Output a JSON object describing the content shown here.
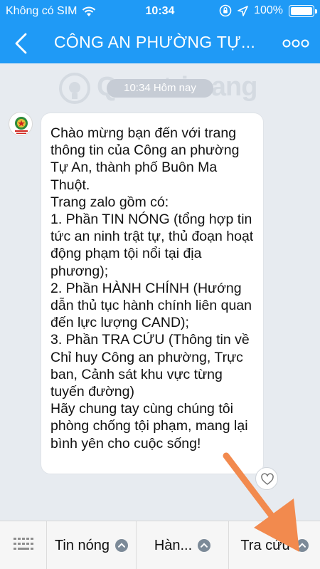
{
  "status_bar": {
    "carrier": "Không có SIM",
    "time": "10:34",
    "battery": "100%"
  },
  "header": {
    "title": "CÔNG AN PHƯỜNG TỰ...",
    "back_icon": "chevron-left-icon",
    "more_icon": "more-dots-icon"
  },
  "chat": {
    "timestamp": "10:34 Hôm nay",
    "watermark": "Quantrimang",
    "message": "Chào mừng bạn đến với trang thông tin của Công an phường Tự An, thành phố Buôn Ma Thuột.\n Trang zalo gồm có:\n 1. Phần TIN NÓNG (tổng hợp tin tức an ninh trật tự, thủ đoạn hoạt động phạm tội nổi tại địa phương);\n2. Phần HÀNH CHÍNH (Hướng dẫn thủ tục hành chính liên quan đến lực lượng CAND);\n3. Phần TRA CỨU (Thông tin về Chỉ huy Công an phường, Trực ban, Cảnh sát khu vực từng tuyến đường)\nHãy chung tay cùng chúng tôi phòng chống tội phạm, mang lại bình yên cho cuộc sống!"
  },
  "menu": {
    "items": [
      {
        "label": "Tin nóng"
      },
      {
        "label": "Hàn..."
      },
      {
        "label": "Tra cứu"
      }
    ]
  },
  "colors": {
    "header_blue": "#1f9af6",
    "arrow_orange": "#f28a4e"
  }
}
